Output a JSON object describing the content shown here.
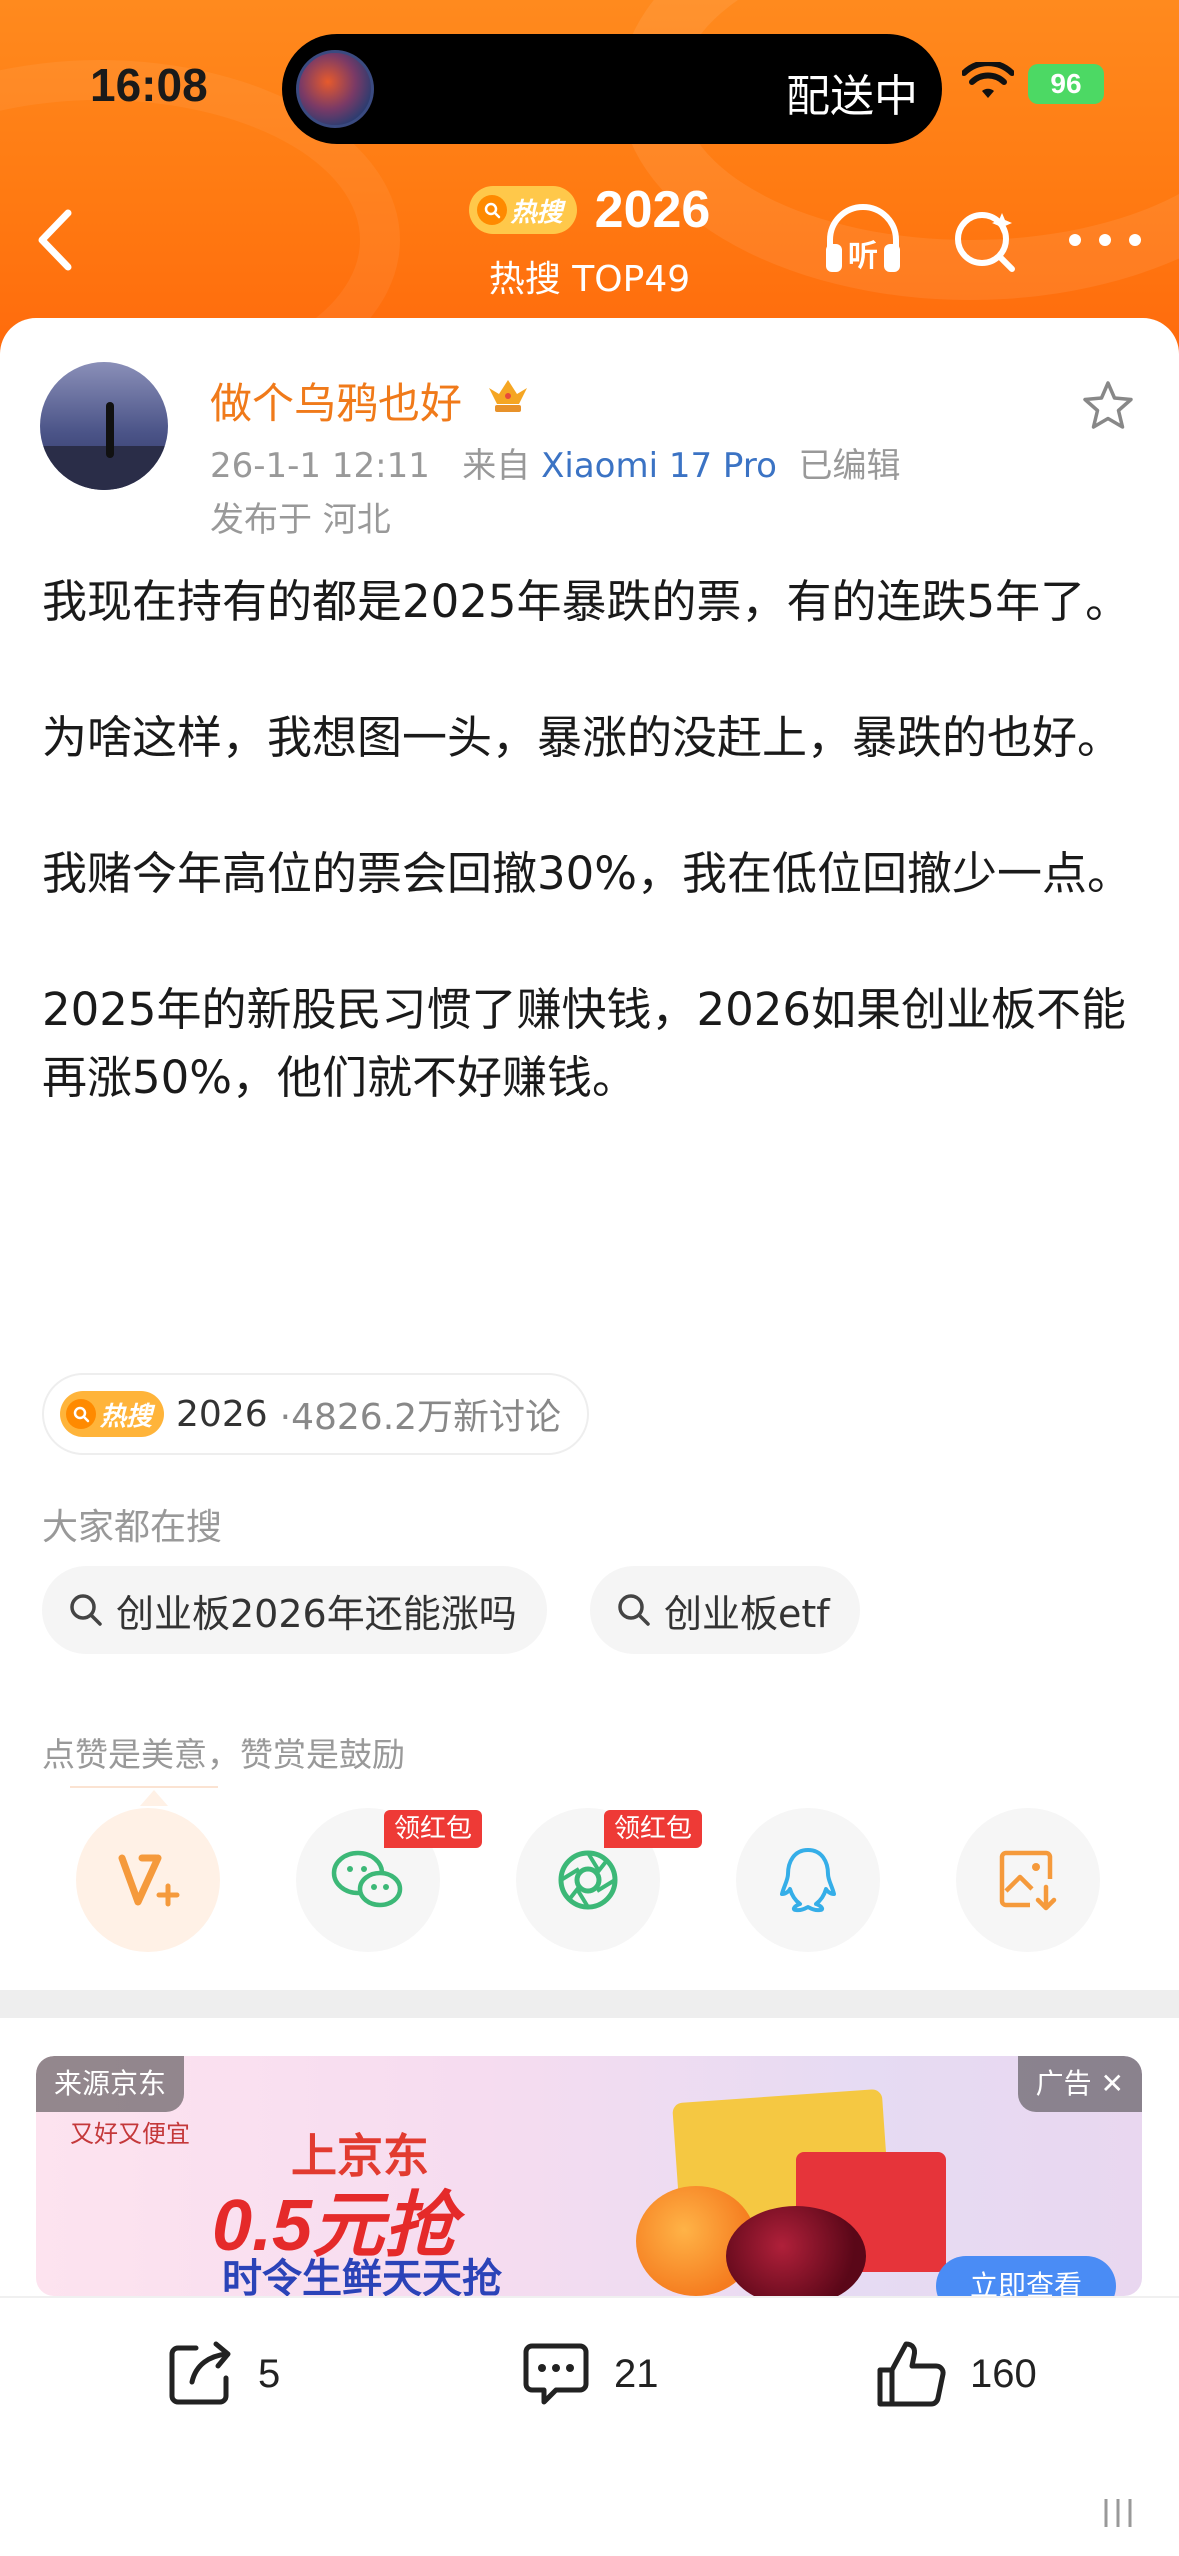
{
  "status_bar": {
    "time": "16:08",
    "island_text": "配送中",
    "battery": "96"
  },
  "header": {
    "hot_badge": "热搜",
    "hot_word": "2026",
    "hot_rank": "热搜 TOP49"
  },
  "post": {
    "author": "做个乌鸦也好",
    "datetime": "26-1-1 12:11",
    "source_prefix": "来自",
    "device": "Xiaomi 17 Pro",
    "edited": "已编辑",
    "location": "发布于 河北",
    "paragraphs": [
      "我现在持有的都是2025年暴跌的票，有的连跌5年了。",
      "为啥这样，我想图一头，暴涨的没赶上，暴跌的也好。",
      "我赌今年高位的票会回撤30%，我在低位回撤少一点。",
      "2025年的新股民习惯了赚快钱，2026如果创业板不能再涨50%，他们就不好赚钱。"
    ]
  },
  "topic": {
    "badge": "热搜",
    "word": "2026",
    "count": "·4826.2万新讨论"
  },
  "searches": {
    "label": "大家都在搜",
    "items": [
      "创业板2026年还能涨吗",
      "创业板etf"
    ]
  },
  "reward": {
    "label": "点赞是美意，赞赏是鼓励",
    "red_tag": "领红包"
  },
  "ad": {
    "source": "来源京东",
    "tag": "广告 ✕",
    "brand": "又好又便宜",
    "line1": "上京东",
    "line2": "0.5元抢",
    "line3": "时令生鲜天天抢",
    "cta": "立即查看"
  },
  "actions": {
    "repost_count": "5",
    "comment_count": "21",
    "like_count": "160"
  },
  "colors": {
    "header_orange": "#ff7a12",
    "username_orange": "#f07a1a",
    "device_blue": "#3b73c4",
    "red_tag": "#ee3a36"
  }
}
